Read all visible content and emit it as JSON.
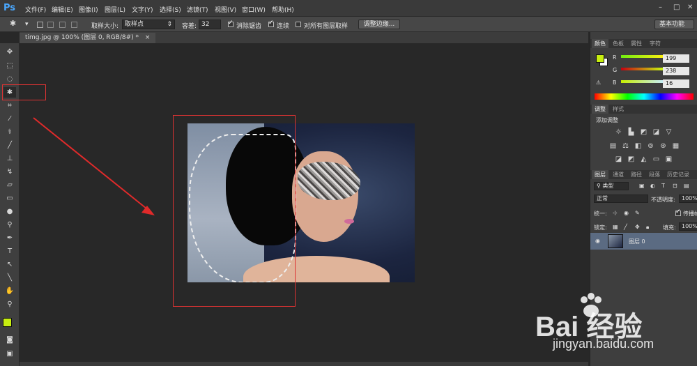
{
  "app": {
    "logo": "Ps"
  },
  "menubar": {
    "items": [
      "文件(F)",
      "编辑(E)",
      "图像(I)",
      "图层(L)",
      "文字(Y)",
      "选择(S)",
      "滤镜(T)",
      "视图(V)",
      "窗口(W)",
      "帮助(H)"
    ]
  },
  "window_controls": {
    "minimize": "–",
    "restore": "□",
    "close": "✕"
  },
  "options": {
    "sample_size_label": "取样大小:",
    "sample_size_value": "取样点",
    "tolerance_label": "容差:",
    "tolerance_value": "32",
    "antialias_label": "消除锯齿",
    "contiguous_label": "连续",
    "all_layers_label": "对所有图层取样",
    "refine_edge_button": "调整边缘...",
    "workspace": "基本功能"
  },
  "document_tab": {
    "title": "timg.jpg @ 100% (图层 0, RGB/8#) *",
    "close": "×"
  },
  "color_panel": {
    "tabs": [
      "颜色",
      "色板",
      "属性",
      "字符"
    ],
    "r": "199",
    "g": "238",
    "b": "16",
    "r_label": "R",
    "g_label": "G",
    "b_label": "B",
    "foreground_color": "#c7ee10"
  },
  "adjust_panel": {
    "tabs": [
      "调整",
      "样式"
    ],
    "heading": "添加调整"
  },
  "layers_panel": {
    "tabs": [
      "图层",
      "通道",
      "路径",
      "段落",
      "历史记录"
    ],
    "filter_kind": "类型",
    "blend_mode": "正常",
    "opacity_label": "不透明度:",
    "opacity_value": "100%",
    "unify_label": "统一:",
    "propagate_label": "传播帧",
    "lock_label": "锁定:",
    "fill_label": "填充:",
    "fill_value": "100%",
    "layer_name": "图层 0"
  },
  "watermark": {
    "line1": "Bai 经验",
    "line2": "jingyan.baidu.com"
  }
}
